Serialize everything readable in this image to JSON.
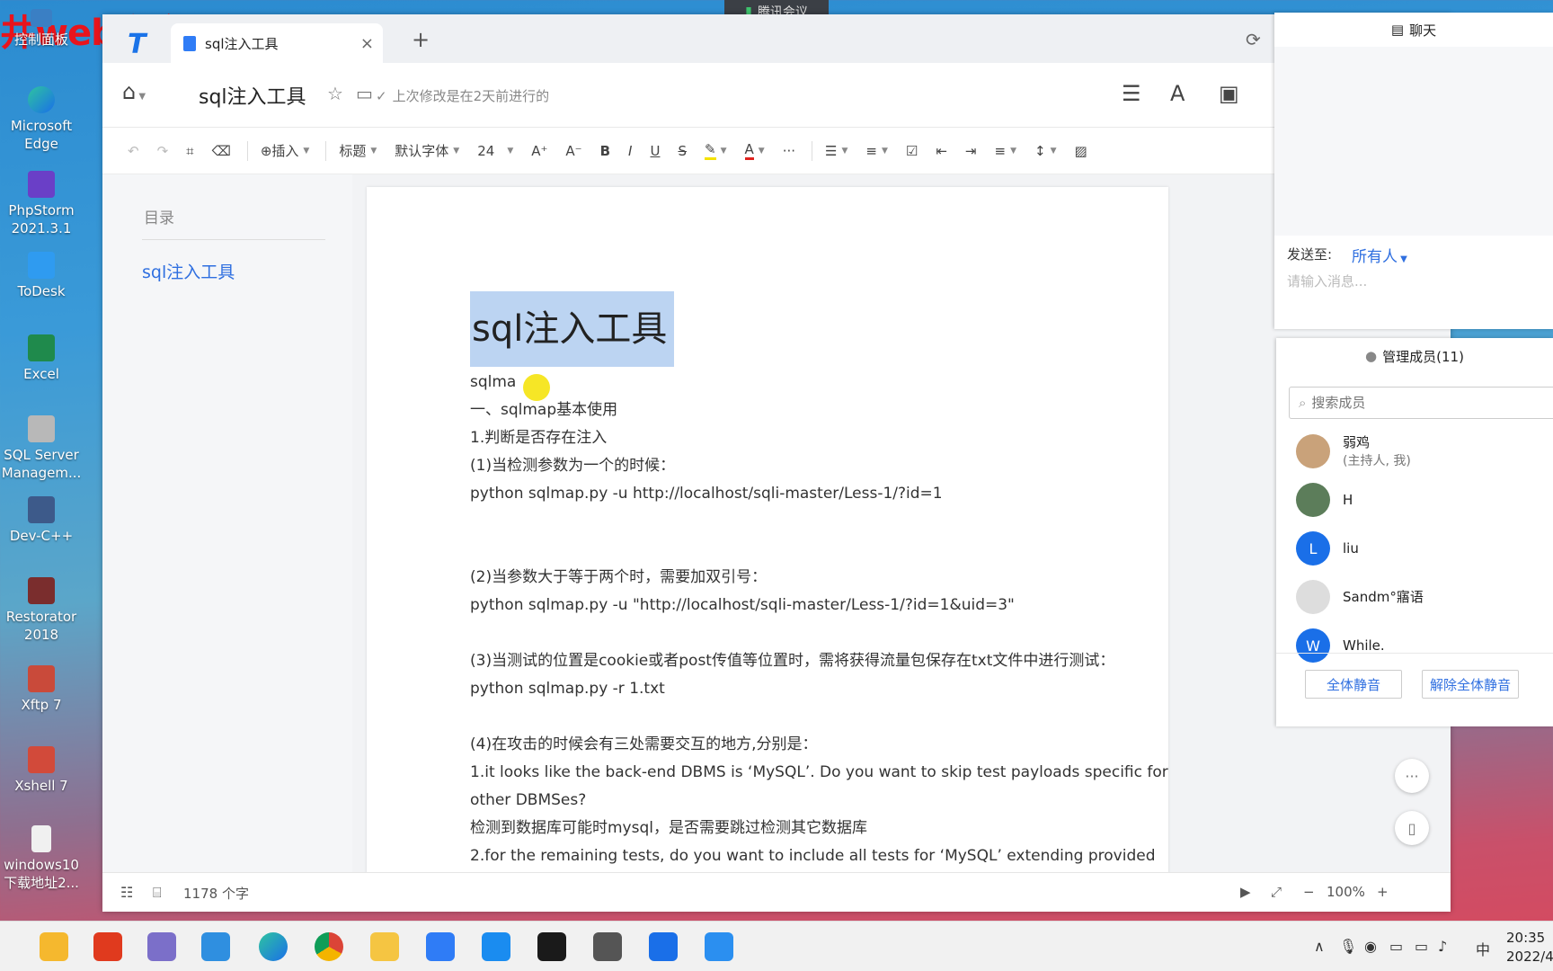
{
  "desktop": {
    "overlay_text": "井web安全",
    "icons": [
      "控制面板",
      "Microsoft Edge",
      "PhpStorm 2021.3.1",
      "ToDesk",
      "Excel",
      "SQL Server Managem...",
      "Dev-C++",
      "Restorator 2018",
      "Xftp 7",
      "Xshell 7",
      "windows10下载地址2..."
    ]
  },
  "meeting": {
    "label": "腾讯会议"
  },
  "browser": {
    "tab_title": "sql注入工具",
    "close_glyph": "×",
    "newtab_glyph": "+"
  },
  "header": {
    "title": "sql注入工具",
    "modified": "上次修改是在2天前进行的"
  },
  "toolbar": {
    "insert": "插入",
    "style": "标题",
    "font": "默认字体",
    "size": "24",
    "more": "···"
  },
  "sidebar": {
    "title": "目录",
    "items": [
      "sql注入工具"
    ]
  },
  "document": {
    "heading": "sql注入工具",
    "lines": [
      "sqlma",
      "一、sqlmap基本使用",
      "1.判断是否存在注入",
      "(1)当检测参数为一个的时候：",
      "python sqlmap.py -u http://localhost/sqli-master/Less-1/?id=1",
      "",
      "",
      "(2)当参数大于等于两个时，需要加双引号：",
      "python sqlmap.py -u \"http://localhost/sqli-master/Less-1/?id=1&uid=3\"",
      "",
      "(3)当测试的位置是cookie或者post传值等位置时，需将获得流量包保存在txt文件中进行测试：",
      "python sqlmap.py -r 1.txt",
      "",
      "(4)在攻击的时候会有三处需要交互的地方,分别是：",
      "1.it looks like the back-end DBMS is ‘MySQL’. Do you want to skip test payloads specific for",
      "other DBMSes?",
      "检测到数据库可能时mysql，是否需要跳过检测其它数据库",
      "2.for the remaining tests, do you want to include all tests for ‘MySQL’ extending provided"
    ]
  },
  "status": {
    "word_count": "1178 个字",
    "zoom": "100%",
    "minus": "−",
    "plus": "+"
  },
  "chat": {
    "title": "聊天",
    "send_to_label": "发送至:",
    "send_to_value": "所有人",
    "input_placeholder": "请输入消息..."
  },
  "members": {
    "title": "管理成员(11)",
    "search_placeholder": "搜索成员",
    "list": [
      {
        "name": "弱鸡",
        "sub": "(主持人, 我)",
        "initial": "",
        "color": "#c9a27a"
      },
      {
        "name": "H",
        "sub": "",
        "initial": "",
        "color": "#5c7d5a"
      },
      {
        "name": "liu",
        "sub": "",
        "initial": "L",
        "color": "#1a6fe8"
      },
      {
        "name": "Sandm°寤语",
        "sub": "",
        "initial": "",
        "color": "#dddddd"
      },
      {
        "name": "While.",
        "sub": "",
        "initial": "W",
        "color": "#1a6fe8"
      }
    ],
    "mute_all": "全体静音",
    "unmute_all": "解除全体静音"
  },
  "taskbar": {
    "ime": "中",
    "time": "20:35",
    "date": "2022/4/"
  }
}
